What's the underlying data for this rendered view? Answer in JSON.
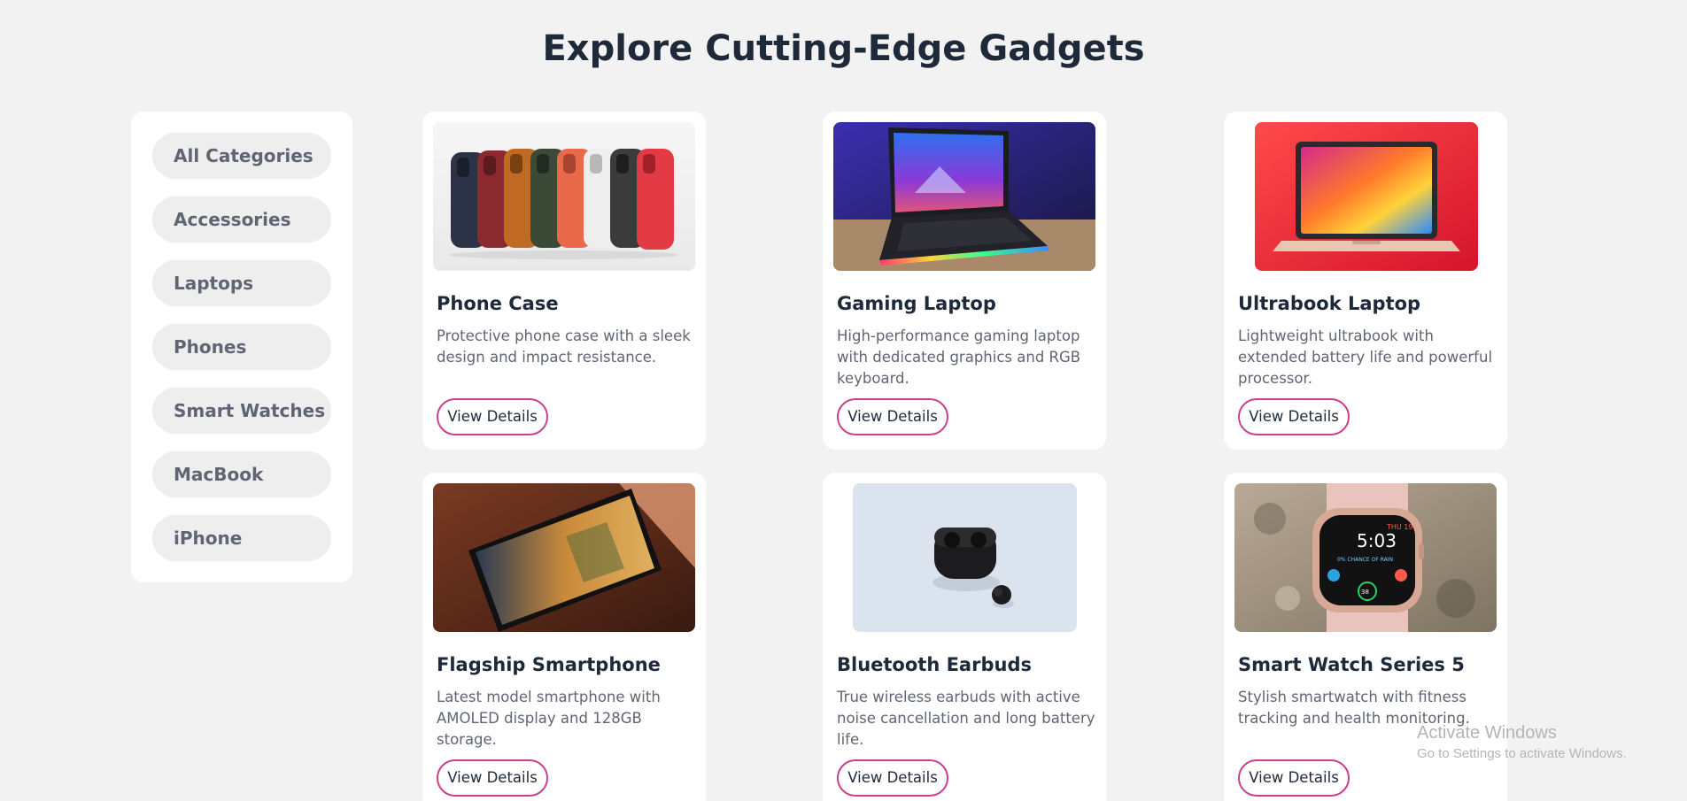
{
  "page": {
    "title": "Explore Cutting-Edge Gadgets"
  },
  "sidebar": {
    "categories": [
      {
        "label": "All Categories"
      },
      {
        "label": "Accessories"
      },
      {
        "label": "Laptops"
      },
      {
        "label": "Phones"
      },
      {
        "label": "Smart Watches"
      },
      {
        "label": "MacBook"
      },
      {
        "label": "iPhone"
      }
    ]
  },
  "products": [
    {
      "title": "Phone Case",
      "description": "Protective phone case with a sleek design and impact resistance.",
      "button_label": "View Details",
      "image_subject": "phone-cases-photo"
    },
    {
      "title": "Gaming Laptop",
      "description": "High-performance gaming laptop with dedicated graphics and RGB keyboard.",
      "button_label": "View Details",
      "image_subject": "gaming-laptop-photo"
    },
    {
      "title": "Ultrabook Laptop",
      "description": "Lightweight ultrabook with extended battery life and powerful processor.",
      "button_label": "View Details",
      "image_subject": "ultrabook-photo"
    },
    {
      "title": "Flagship Smartphone",
      "description": "Latest model smartphone with AMOLED display and 128GB storage.",
      "button_label": "View Details",
      "image_subject": "smartphone-photo"
    },
    {
      "title": "Bluetooth Earbuds",
      "description": "True wireless earbuds with active noise cancellation and long battery life.",
      "button_label": "View Details",
      "image_subject": "earbuds-photo"
    },
    {
      "title": "Smart Watch Series 5",
      "description": "Stylish smartwatch with fitness tracking and health monitoring.",
      "button_label": "View Details",
      "image_subject": "smartwatch-photo",
      "watch_time": "5:03",
      "watch_day": "THU 19",
      "watch_rain": "0% CHANCE OF RAIN",
      "watch_ring": "38"
    }
  ],
  "watermark": {
    "title": "Activate Windows",
    "subtitle": "Go to Settings to activate Windows."
  },
  "colors": {
    "background": "#f2f2f2",
    "card": "#ffffff",
    "heading": "#1e2a3a",
    "body_text": "#5f6672",
    "pill": "#eeeeee",
    "button_border": "#cc3f8e"
  }
}
